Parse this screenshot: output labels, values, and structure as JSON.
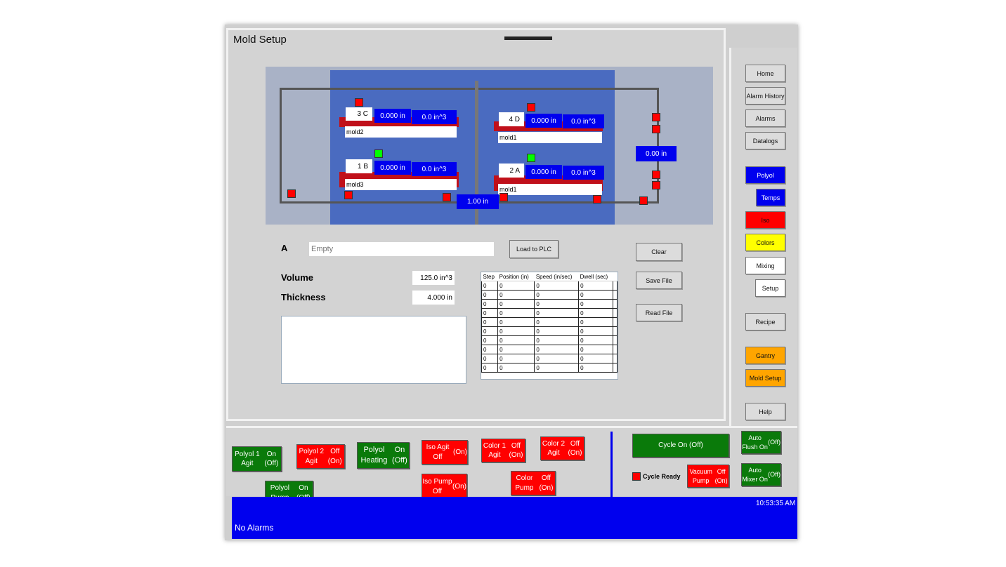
{
  "window": {
    "title": "Mold Setup"
  },
  "diagram": {
    "stations": [
      {
        "label": "3 C",
        "position": "0.000 in",
        "volume": "0.0 in^3",
        "mold": "mold2"
      },
      {
        "label": "4 D",
        "position": "0.000 in",
        "volume": "0.0 in^3",
        "mold": "mold1"
      },
      {
        "label": "1 B",
        "position": "0.000 in",
        "volume": "0.0 in^3",
        "mold": "mold3"
      },
      {
        "label": "2 A",
        "position": "0.000 in",
        "volume": "0.0 in^3",
        "mold": "mold1"
      }
    ],
    "center_position": "1.00 in",
    "right_position": "0.00 in",
    "colors": {
      "on": "#00ff00",
      "off": "#ff0000",
      "value_bg": "#0000ee"
    }
  },
  "form": {
    "station_letter": "A",
    "name_value": "Empty",
    "load_button": "Load to PLC",
    "volume_label": "Volume",
    "volume_value": "125.0 in^3",
    "thickness_label": "Thickness",
    "thickness_value": "4.000 in",
    "notes_value": "",
    "clear_button": "Clear",
    "save_button": "Save File",
    "read_button": "Read File"
  },
  "steps_table": {
    "headers": [
      "Step",
      "Position (in)",
      "Speed (in/sec)",
      "Dwell (sec)"
    ],
    "rows": [
      [
        "0",
        "0",
        "0",
        "0"
      ],
      [
        "0",
        "0",
        "0",
        "0"
      ],
      [
        "0",
        "0",
        "0",
        "0"
      ],
      [
        "0",
        "0",
        "0",
        "0"
      ],
      [
        "0",
        "0",
        "0",
        "0"
      ],
      [
        "0",
        "0",
        "0",
        "0"
      ],
      [
        "0",
        "0",
        "0",
        "0"
      ],
      [
        "0",
        "0",
        "0",
        "0"
      ],
      [
        "0",
        "0",
        "0",
        "0"
      ],
      [
        "0",
        "0",
        "0",
        "0"
      ]
    ]
  },
  "nav": {
    "items": [
      "Home",
      "Alarm History",
      "Alarms",
      "Datalogs",
      "Polyol",
      "Temps",
      "Iso",
      "Colors",
      "Mixing",
      "Setup",
      "Recipe",
      "Gantry",
      "Mold Setup",
      "Help"
    ]
  },
  "controls": {
    "polyol1_agit": [
      "Polyol 1 Agit",
      "On (Off)"
    ],
    "polyol2_agit": [
      "Polyol 2 Agit",
      "Off (On)"
    ],
    "polyol_heating": [
      "Polyol Heating",
      "On (Off)"
    ],
    "iso_agit": [
      "Iso Agit Off",
      "(On)"
    ],
    "color1_agit": [
      "Color 1 Agit",
      "Off (On)"
    ],
    "color2_agit": [
      "Color 2 Agit",
      "Off (On)"
    ],
    "polyol_pump": [
      "Polyol Pump",
      "On (Off)"
    ],
    "iso_pump": [
      "Iso Pump Off",
      "(On)"
    ],
    "color_pump": [
      "Color Pump",
      "Off (On)"
    ],
    "cycle": "Cycle On (Off)",
    "auto_flush": [
      "Auto Flush On",
      "(Off)"
    ],
    "cycle_ready": "Cycle Ready",
    "vacuum_pump": [
      "Vacuum Pump",
      "Off (On)"
    ],
    "auto_mixer": [
      "Auto Mixer On",
      "(Off)"
    ]
  },
  "status": {
    "alarms": "No Alarms",
    "time": "10:53:35 AM"
  }
}
